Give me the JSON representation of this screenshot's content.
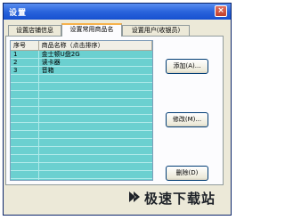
{
  "window": {
    "title": "设置",
    "close_label": "×"
  },
  "tabs": [
    {
      "label": "设置店铺信息",
      "active": false
    },
    {
      "label": "设置常用商品名",
      "active": true
    },
    {
      "label": "设置用户(收银员)",
      "active": false
    }
  ],
  "grid": {
    "columns": [
      "序号",
      "商品名称（点击排序）"
    ],
    "rows": [
      {
        "index": "1",
        "name": "金士顿U盘2G"
      },
      {
        "index": "2",
        "name": "读卡器"
      },
      {
        "index": "3",
        "name": "音箱"
      }
    ],
    "row_color": "#6bd0d0"
  },
  "buttons": {
    "add": "添加(A)...",
    "edit": "修改(M)...",
    "delete": "删除(D)"
  },
  "watermark": {
    "text": "极速下载站",
    "icon": "download-site-logo"
  },
  "colors": {
    "titlebar": "#2a64dc",
    "active_tab_accent": "#f6b24c",
    "dialog_background": "#ece9d8"
  }
}
